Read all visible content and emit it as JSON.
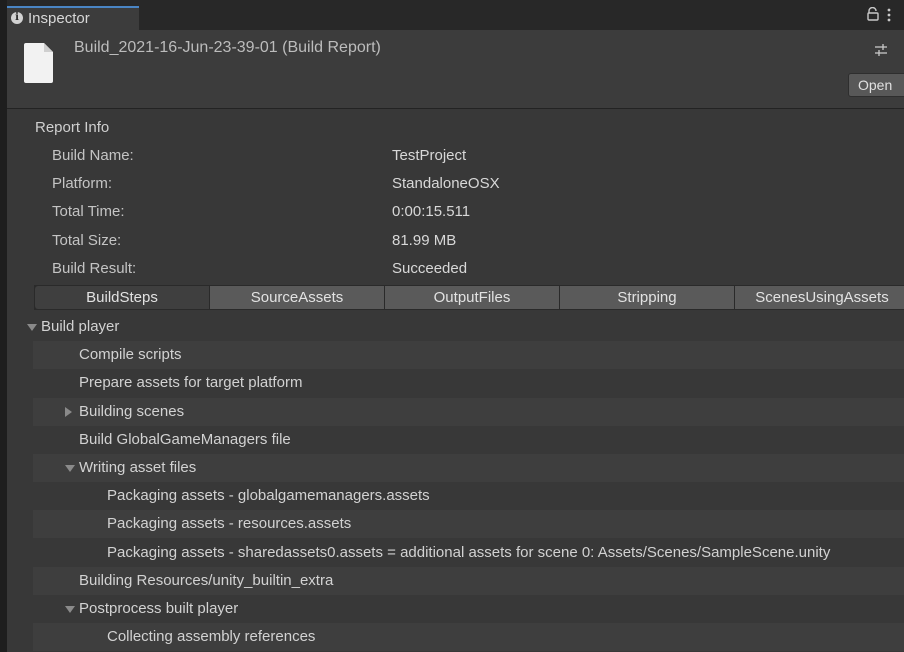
{
  "window": {
    "tab_label": "Inspector",
    "tab_icon": "info-icon",
    "lock_icon": "lock-icon",
    "menu_icon": "kebab-menu-icon"
  },
  "header": {
    "title": "Build_2021-16-Jun-23-39-01 (Build Report)",
    "file_icon": "file-icon",
    "settings_icon": "settings-sliders-icon",
    "open_label": "Open"
  },
  "report_info": {
    "heading": "Report Info",
    "fields": [
      {
        "label": "Build Name:",
        "value": "TestProject"
      },
      {
        "label": "Platform:",
        "value": "StandaloneOSX"
      },
      {
        "label": "Total Time:",
        "value": "0:00:15.511"
      },
      {
        "label": "Total Size:",
        "value": "81.99 MB"
      },
      {
        "label": "Build Result:",
        "value": "Succeeded"
      }
    ]
  },
  "toolbar": {
    "buttons": [
      "BuildSteps",
      "SourceAssets",
      "OutputFiles",
      "Stripping",
      "ScenesUsingAssets"
    ],
    "active": "BuildSteps"
  },
  "build_steps": [
    {
      "label": "Build player",
      "depth": 0,
      "arrow": "down"
    },
    {
      "label": "Compile scripts",
      "depth": 1,
      "arrow": "none"
    },
    {
      "label": "Prepare assets for target platform",
      "depth": 1,
      "arrow": "none"
    },
    {
      "label": "Building scenes",
      "depth": 1,
      "arrow": "right"
    },
    {
      "label": "Build GlobalGameManagers file",
      "depth": 1,
      "arrow": "none"
    },
    {
      "label": "Writing asset files",
      "depth": 1,
      "arrow": "down"
    },
    {
      "label": "Packaging assets - globalgamemanagers.assets",
      "depth": 2,
      "arrow": "none"
    },
    {
      "label": "Packaging assets - resources.assets",
      "depth": 2,
      "arrow": "none"
    },
    {
      "label": "Packaging assets - sharedassets0.assets = additional assets for scene 0: Assets/Scenes/SampleScene.unity",
      "depth": 2,
      "arrow": "none"
    },
    {
      "label": "Building Resources/unity_builtin_extra",
      "depth": 1,
      "arrow": "none"
    },
    {
      "label": "Postprocess built player",
      "depth": 1,
      "arrow": "down"
    },
    {
      "label": "Collecting assembly references",
      "depth": 2,
      "arrow": "none"
    }
  ]
}
